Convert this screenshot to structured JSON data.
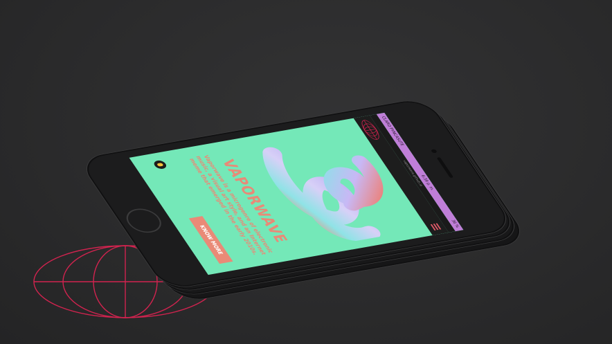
{
  "status_bar": {
    "carrier": "CLARO PYNCASUTE",
    "time": "6:39 p. m.",
    "battery": "36 %"
  },
  "url": "vaporwave.github.io",
  "site": {
    "title": "VAPORWAVE",
    "description": "Vaporwave is a microgenre of electronic music, a visual art style, and an Internet meme that emerged in the early 2010s.",
    "cta_label": "KNOW MORE"
  },
  "icons": {
    "menu": "hamburger-icon",
    "logo": "globe-icon",
    "theme_toggle": "toggle-icon"
  },
  "colors": {
    "background": "#2a2a2b",
    "screen_bg": "#74e8b8",
    "status_bar": "#c07ed8",
    "accent": "#e98a77",
    "logo_line": "#d2234f"
  }
}
